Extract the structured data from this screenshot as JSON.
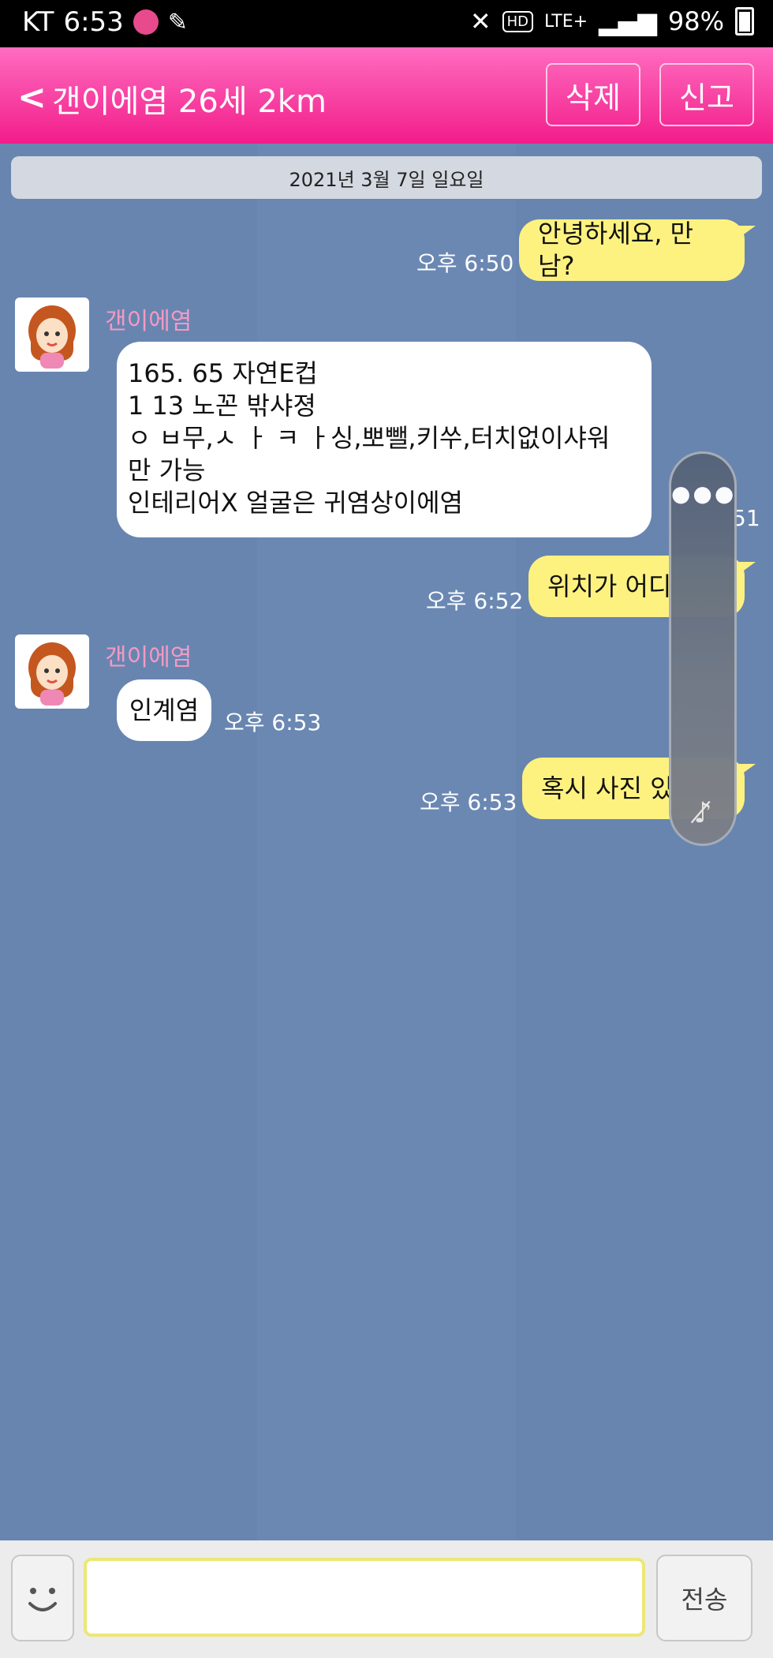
{
  "status_bar": {
    "carrier": "KT",
    "time": "6:53",
    "hd_label": "HD",
    "network": "LTE+",
    "battery": "98%"
  },
  "header": {
    "back_icon": "chevron-left-icon",
    "title": "갠이에염 26세 2km",
    "delete_label": "삭제",
    "report_label": "신고",
    "colors": {
      "top": "#ff6cc0",
      "bottom": "#f21d8a"
    }
  },
  "chat": {
    "date": "2021년 3월 7일 일요일",
    "messages": [
      {
        "side": "me",
        "text": "안녕하세요, 만남?",
        "time": "오후 6:50"
      },
      {
        "side": "other",
        "sender": "갠이에염",
        "lines": [
          "165. 65 자연E컵",
          "1  13 노꼰 밖샤졍",
          "ㅇ ㅂ무,ㅅ ㅏ ㅋ ㅏ싱,뽀뺄,키쑤,터치없이샤워",
          "만 가능",
          "인테리어X  얼굴은 귀염상이에염"
        ],
        "time_partial": "51"
      },
      {
        "side": "me",
        "text": "위치가 어디",
        "time": "오후 6:52"
      },
      {
        "side": "other",
        "sender": "갠이에염",
        "text": "인계염",
        "time": "오후 6:53"
      },
      {
        "side": "me",
        "text": "혹시 사진 있",
        "time": "오후 6:53"
      }
    ]
  },
  "floating_panel": {
    "menu_icon": "more-dots-icon",
    "mute_icon": "music-mute-icon"
  },
  "bottom": {
    "input_value": "",
    "send_label": "전송",
    "emoji_icon": "smiley-icon"
  },
  "colors": {
    "chat_bg": "#6885b0",
    "my_bubble": "#fdf280",
    "other_bubble": "#ffffff",
    "sender_name": "#f39ac4"
  }
}
